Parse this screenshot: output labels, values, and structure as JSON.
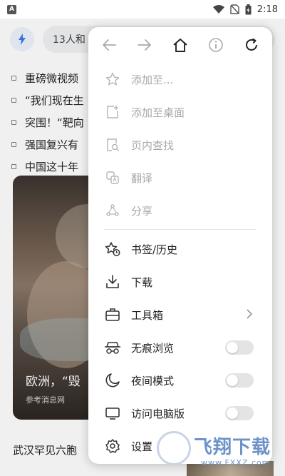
{
  "status_bar": {
    "left_icon": "A",
    "time": "2:18",
    "icons": [
      "wifi-icon",
      "no-sim-icon",
      "battery-icon"
    ]
  },
  "background_page": {
    "search_placeholder": "13人和",
    "news_items": [
      "重磅微视频",
      "“我们现在生",
      "突围！“靶向",
      "强国复兴有",
      "中国这十年"
    ],
    "feature_card": {
      "title": "欧洲，“毁",
      "source": "参考消息网"
    },
    "bottom_headline": "武汉罕见六胞"
  },
  "menu": {
    "nav_icons": [
      "back-arrow-icon",
      "forward-arrow-icon",
      "home-icon",
      "info-icon",
      "refresh-icon"
    ],
    "items": [
      {
        "label": "添加至...",
        "icon": "star-outline-icon",
        "enabled": false
      },
      {
        "label": "添加至桌面",
        "icon": "add-to-desktop-icon",
        "enabled": false
      },
      {
        "label": "页内查找",
        "icon": "find-in-page-icon",
        "enabled": false
      },
      {
        "label": "翻译",
        "icon": "translate-icon",
        "enabled": false
      },
      {
        "label": "分享",
        "icon": "share-icon",
        "enabled": false
      },
      {
        "label": "书签/历史",
        "icon": "bookmark-history-icon",
        "enabled": true
      },
      {
        "label": "下载",
        "icon": "download-icon",
        "enabled": true
      },
      {
        "label": "工具箱",
        "icon": "toolbox-icon",
        "enabled": true,
        "chevron": true
      },
      {
        "label": "无痕浏览",
        "icon": "incognito-icon",
        "enabled": true,
        "toggle": false
      },
      {
        "label": "夜间模式",
        "icon": "moon-icon",
        "enabled": true,
        "toggle": false
      },
      {
        "label": "访问电脑版",
        "icon": "desktop-monitor-icon",
        "enabled": true,
        "toggle": false
      },
      {
        "label": "设置",
        "icon": "settings-gear-icon",
        "enabled": true
      }
    ]
  },
  "watermark": {
    "text": "飞翔下载",
    "url": "www.FXXZ.com"
  },
  "colors": {
    "accent_blue": "#3a7bf0",
    "disabled_text": "#a8a8a8",
    "toggle_off": "#e4e4e4"
  }
}
